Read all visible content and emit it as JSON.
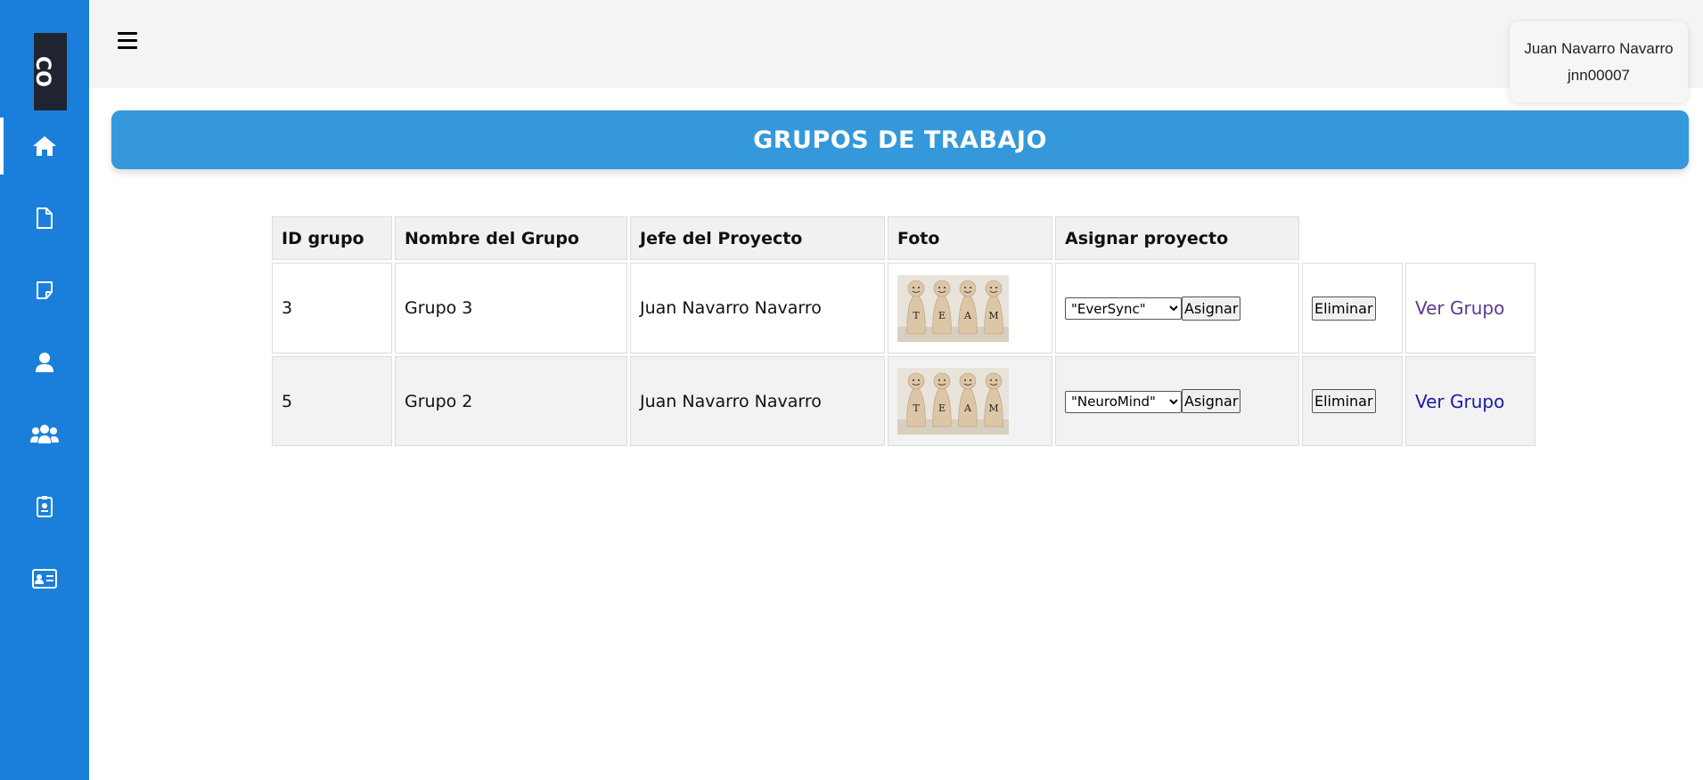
{
  "app": {
    "logo_text": "CO",
    "page_title": "GRUPOS DE TRABAJO",
    "colors": {
      "sidebar": "#1a7fdb",
      "banner": "#3498db",
      "topbar": "#f4f4f4"
    }
  },
  "sidebar": {
    "items": [
      {
        "icon": "home-icon",
        "active": true
      },
      {
        "icon": "document-icon",
        "active": false
      },
      {
        "icon": "note-icon",
        "active": false
      },
      {
        "icon": "user-icon",
        "active": false
      },
      {
        "icon": "users-group-icon",
        "active": false
      },
      {
        "icon": "id-badge-icon",
        "active": false
      },
      {
        "icon": "id-card-icon",
        "active": false
      }
    ]
  },
  "user": {
    "name": "Juan Navarro Navarro",
    "username": "jnn00007"
  },
  "table": {
    "headers": [
      "ID grupo",
      "Nombre del Grupo",
      "Jefe del Proyecto",
      "Foto",
      "Asignar proyecto"
    ],
    "rows": [
      {
        "id": "3",
        "name": "Grupo 3",
        "leader": "Juan Navarro Navarro",
        "project": "\"EverSync\"",
        "assign": "Asignar",
        "delete": "Eliminar",
        "view": "Ver Grupo"
      },
      {
        "id": "5",
        "name": "Grupo 2",
        "leader": "Juan Navarro Navarro",
        "project": "\"NeuroMind\"",
        "assign": "Asignar",
        "delete": "Eliminar",
        "view": "Ver Grupo"
      }
    ],
    "photo_letters": [
      "T",
      "E",
      "A",
      "M"
    ]
  }
}
